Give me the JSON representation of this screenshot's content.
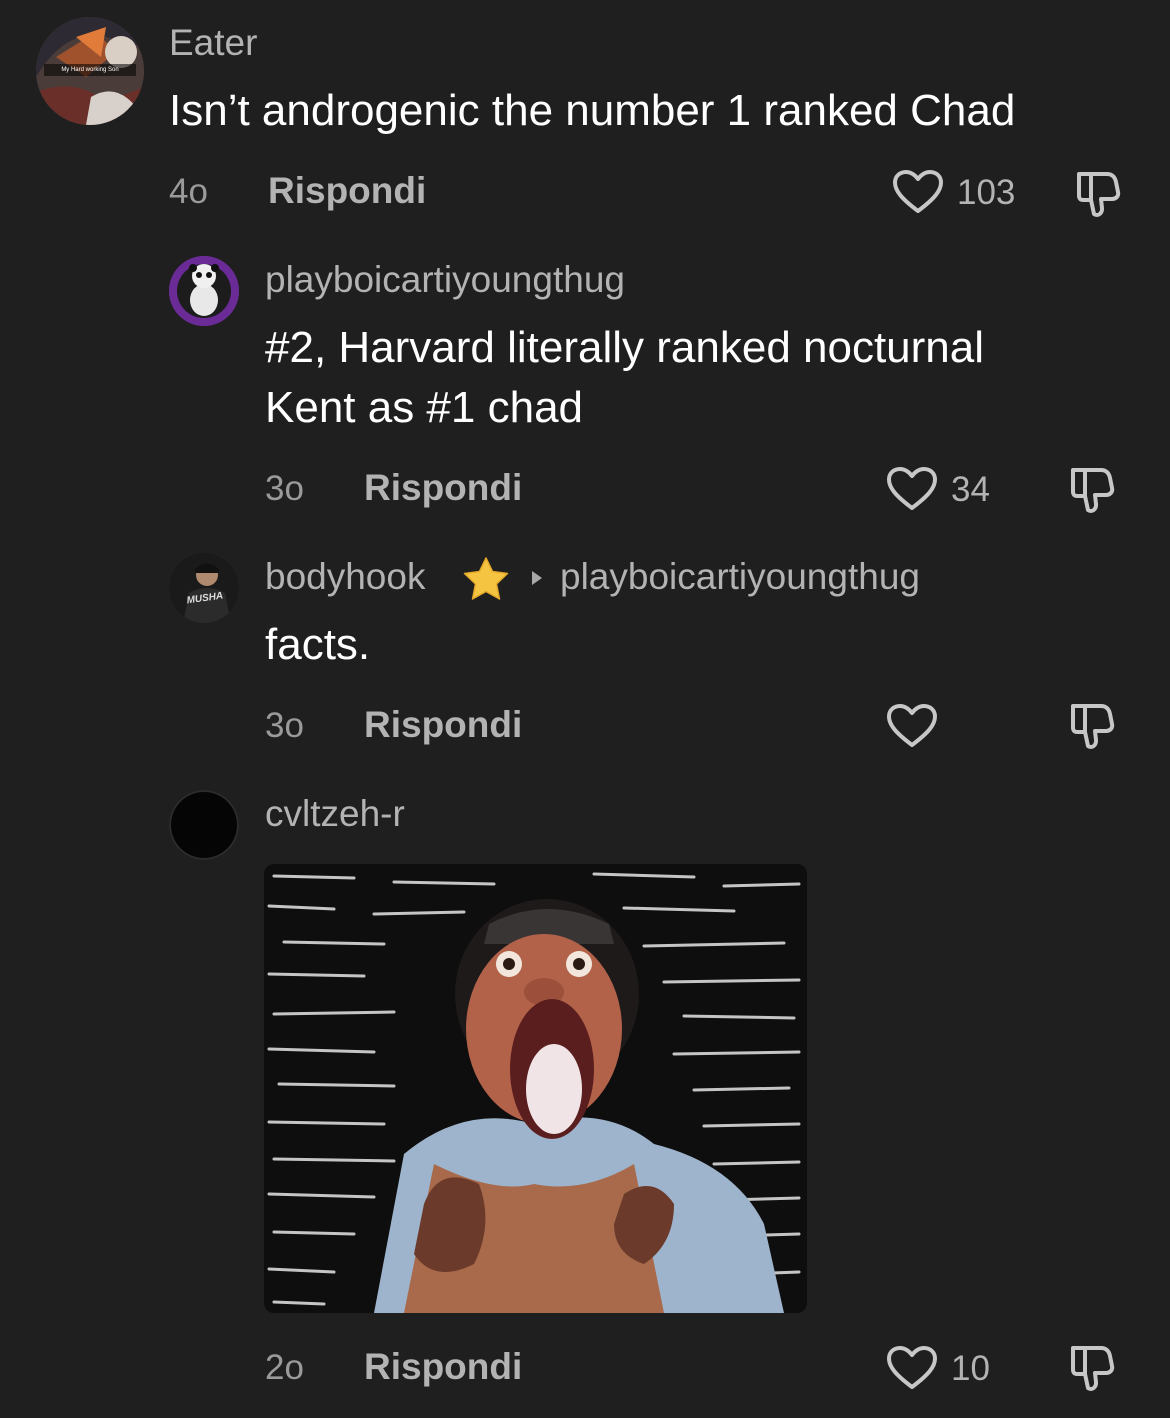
{
  "comments": [
    {
      "username": "Eater",
      "text": "Isn’t androgenic the number 1 ranked Chad",
      "age": "4o",
      "reply_label": "Rispondi",
      "likes": "103",
      "avatar_caption": "My Hard working Son"
    },
    {
      "username": "playboicartiyoungthug",
      "text_line1": "#2, Harvard literally ranked nocturnal",
      "text_line2": "Kent as #1 chad",
      "age": "3o",
      "reply_label": "Rispondi",
      "likes": "34"
    },
    {
      "username": "bodyhook",
      "reply_to": "playboicartiyoungthug",
      "text": "facts.",
      "age": "3o",
      "reply_label": "Rispondi",
      "likes": "",
      "avatar_caption": "MUSHA"
    },
    {
      "username": "cvltzeh-r",
      "age": "2o",
      "reply_label": "Rispondi",
      "likes": "10"
    }
  ],
  "icons": {
    "like": "heart-outline-icon",
    "dislike": "thumbs-down-icon",
    "badge": "star-icon",
    "reply_arrow": "triangle-right-icon"
  },
  "colors": {
    "background": "#1f1f1f",
    "primary_text": "#ffffff",
    "secondary_text": "#b3b3b3",
    "star": "#f5c542"
  }
}
